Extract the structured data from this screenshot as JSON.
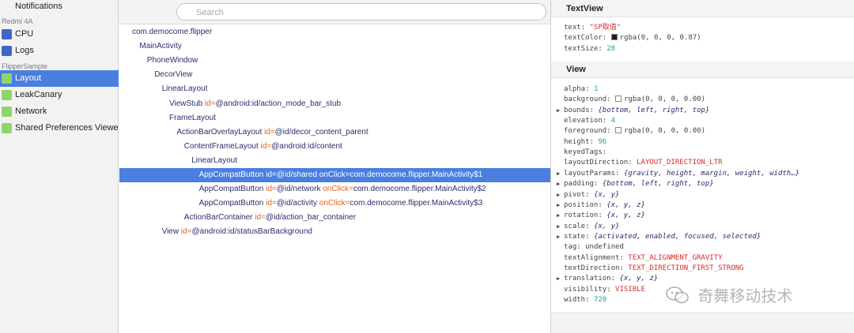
{
  "sidebar": {
    "notifications_label": "Notifications",
    "device_header": "Redmi 4A",
    "device_items": [
      {
        "label": "CPU",
        "icon": "cpu-plugin-icon",
        "color": "#3f66c4"
      },
      {
        "label": "Logs",
        "icon": "logs-plugin-icon",
        "color": "#3f66c4"
      }
    ],
    "app_header": "FlipperSample",
    "app_items": [
      {
        "label": "Layout",
        "icon": "layout-plugin-icon",
        "color": "#8fd66a",
        "selected": true
      },
      {
        "label": "LeakCanary",
        "icon": "leakcanary-plugin-icon",
        "color": "#8fd66a"
      },
      {
        "label": "Network",
        "icon": "network-plugin-icon",
        "color": "#8fd66a"
      },
      {
        "label": "Shared Preferences Viewer",
        "icon": "shared-prefs-plugin-icon",
        "color": "#8fd66a"
      }
    ],
    "selected_color": "#4a7fe0"
  },
  "search": {
    "placeholder": "Search"
  },
  "tree": [
    {
      "node": "com.democome.flipper",
      "attrs": []
    },
    {
      "node": "MainActivity",
      "attrs": []
    },
    {
      "node": "PhoneWindow",
      "attrs": []
    },
    {
      "node": "DecorView",
      "attrs": []
    },
    {
      "node": "LinearLayout",
      "attrs": []
    },
    {
      "node": "ViewStub",
      "attrs": [
        {
          "name": "id=",
          "value": "@android:id/action_mode_bar_stub"
        }
      ]
    },
    {
      "node": "FrameLayout",
      "attrs": []
    },
    {
      "node": "ActionBarOverlayLayout",
      "attrs": [
        {
          "name": "id=",
          "value": "@id/decor_content_parent"
        }
      ]
    },
    {
      "node": "ContentFrameLayout",
      "attrs": [
        {
          "name": "id=",
          "value": "@android:id/content"
        }
      ]
    },
    {
      "node": "LinearLayout",
      "attrs": []
    },
    {
      "node": "AppCompatButton",
      "selected": true,
      "attrs": [
        {
          "name": "id=",
          "value": "@id/shared"
        },
        {
          "name": "onClick=",
          "value": "com.democome.flipper.MainActivity$1"
        }
      ]
    },
    {
      "node": "AppCompatButton",
      "attrs": [
        {
          "name": "id=",
          "value": "@id/network"
        },
        {
          "name": "onClick=",
          "value": "com.democome.flipper.MainActivity$2"
        }
      ]
    },
    {
      "node": "AppCompatButton",
      "attrs": [
        {
          "name": "id=",
          "value": "@id/activity"
        },
        {
          "name": "onClick=",
          "value": "com.democome.flipper.MainActivity$3"
        }
      ]
    },
    {
      "node": "ActionBarContainer",
      "attrs": [
        {
          "name": "id=",
          "value": "@id/action_bar_container"
        }
      ]
    },
    {
      "node": "View",
      "attrs": [
        {
          "name": "id=",
          "value": "@android:id/statusBarBackground"
        }
      ]
    }
  ],
  "inspector": {
    "textview_title": "TextView",
    "textview_props": [
      {
        "key": "text",
        "value": "\"SP取值\"",
        "kind": "str"
      },
      {
        "key": "textColor",
        "value": "rgba(0, 0, 0, 0.87)",
        "kind": "plain",
        "swatch": "#1a1a1a"
      },
      {
        "key": "textSize",
        "value": "28",
        "kind": "num"
      }
    ],
    "view_title": "View",
    "view_props": [
      {
        "key": "alpha",
        "value": "1",
        "kind": "num"
      },
      {
        "key": "background",
        "value": "rgba(0, 0, 0, 0.00)",
        "kind": "plain",
        "swatch": "#ffffff"
      },
      {
        "key": "bounds",
        "value": "{bottom, left, right, top}",
        "kind": "obj",
        "expand": true
      },
      {
        "key": "elevation",
        "value": "4",
        "kind": "num"
      },
      {
        "key": "foreground",
        "value": "rgba(0, 0, 0, 0.00)",
        "kind": "plain",
        "swatch": "#ffffff"
      },
      {
        "key": "height",
        "value": "96",
        "kind": "num"
      },
      {
        "key": "keyedTags",
        "value": "",
        "kind": "plain"
      },
      {
        "key": "layoutDirection",
        "value": "LAYOUT_DIRECTION_LTR",
        "kind": "str"
      },
      {
        "key": "layoutParams",
        "value": "{gravity, height, margin, weight, width…}",
        "kind": "obj",
        "expand": true
      },
      {
        "key": "padding",
        "value": "{bottom, left, right, top}",
        "kind": "obj",
        "expand": true
      },
      {
        "key": "pivot",
        "value": "{x, y}",
        "kind": "obj",
        "expand": true
      },
      {
        "key": "position",
        "value": "{x, y, z}",
        "kind": "obj",
        "expand": true
      },
      {
        "key": "rotation",
        "value": "{x, y, z}",
        "kind": "obj",
        "expand": true
      },
      {
        "key": "scale",
        "value": "{x, y}",
        "kind": "obj",
        "expand": true
      },
      {
        "key": "state",
        "value": "{activated, enabled, focused, selected}",
        "kind": "obj",
        "expand": true
      },
      {
        "key": "tag",
        "value": "undefined",
        "kind": "plain"
      },
      {
        "key": "textAlignment",
        "value": "TEXT_ALIGNMENT_GRAVITY",
        "kind": "str"
      },
      {
        "key": "textDirection",
        "value": "TEXT_DIRECTION_FIRST_STRONG",
        "kind": "str"
      },
      {
        "key": "translation",
        "value": "{x, y, z}",
        "kind": "obj",
        "expand": true
      },
      {
        "key": "visibility",
        "value": "VISIBLE",
        "kind": "str"
      },
      {
        "key": "width",
        "value": "720",
        "kind": "num"
      }
    ]
  },
  "watermark": {
    "text": "奇舞移动技术",
    "icon": "wechat-logo-icon"
  }
}
